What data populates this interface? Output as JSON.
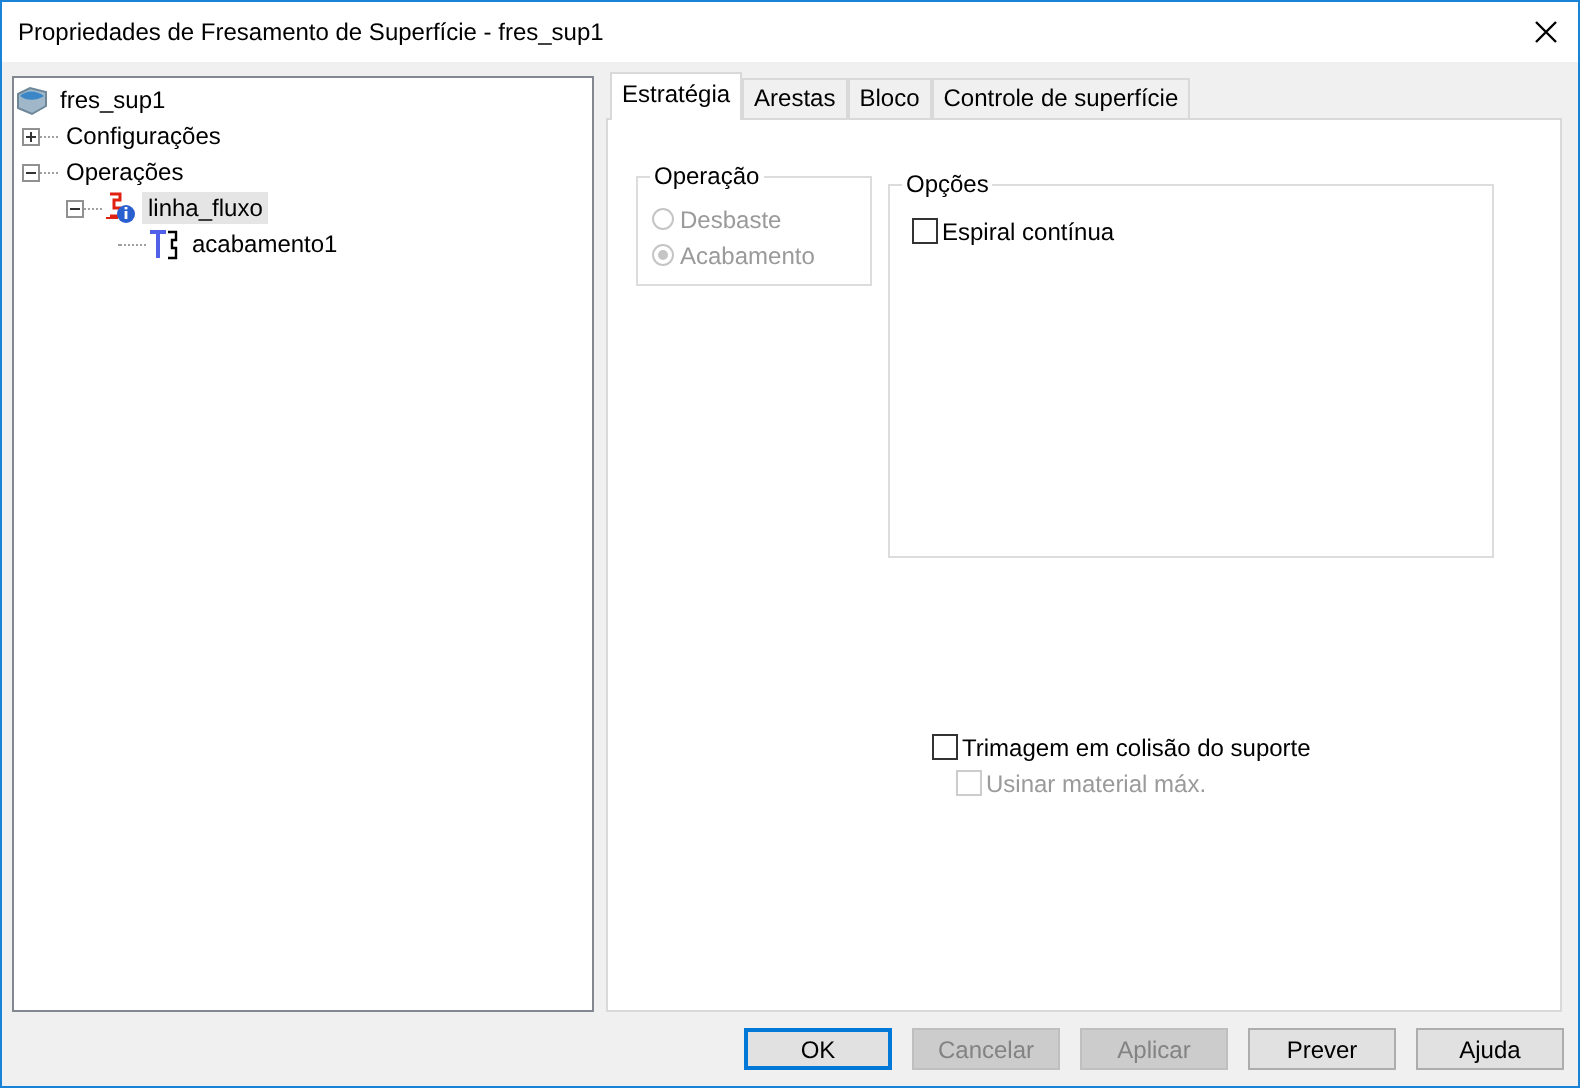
{
  "window": {
    "title": "Propriedades de Fresamento de Superfície - fres_sup1"
  },
  "tree": [
    {
      "label": "fres_sup1",
      "kind": "part",
      "selected": false,
      "children": [
        {
          "label": "Configurações",
          "selected": false,
          "expanded": false
        },
        {
          "label": "Operações",
          "selected": false,
          "expanded": true,
          "children": [
            {
              "label": "linha_fluxo",
              "kind": "operation",
              "selected": true,
              "expanded": true,
              "children": [
                {
                  "label": "acabamento1",
                  "kind": "toolpath",
                  "selected": false
                }
              ]
            }
          ]
        }
      ]
    }
  ],
  "tabs": [
    {
      "label": "Estratégia",
      "selected": true
    },
    {
      "label": "Arestas",
      "selected": false
    },
    {
      "label": "Bloco",
      "selected": false
    },
    {
      "label": "Controle de superfície",
      "selected": false
    }
  ],
  "operation_group": {
    "title": "Operação",
    "options": [
      {
        "label": "Desbaste",
        "selected": false,
        "disabled": true
      },
      {
        "label": "Acabamento",
        "selected": true,
        "disabled": true
      }
    ]
  },
  "options_group": {
    "title": "Opções",
    "checkboxes": [
      {
        "label": "Espiral contínua",
        "checked": false,
        "disabled": false
      }
    ]
  },
  "checkboxes": [
    {
      "label": "Trimagem em colisão do suporte",
      "checked": false,
      "disabled": false,
      "children": [
        {
          "label": "Usinar material máx.",
          "checked": false,
          "disabled": true
        }
      ]
    }
  ],
  "buttons": [
    {
      "label": "OK",
      "default": true,
      "disabled": false
    },
    {
      "label": "Cancelar",
      "default": false,
      "disabled": true
    },
    {
      "label": "Aplicar",
      "default": false,
      "disabled": true
    },
    {
      "label": "Prever",
      "default": false,
      "disabled": false
    },
    {
      "label": "Ajuda",
      "default": false,
      "disabled": false
    }
  ]
}
